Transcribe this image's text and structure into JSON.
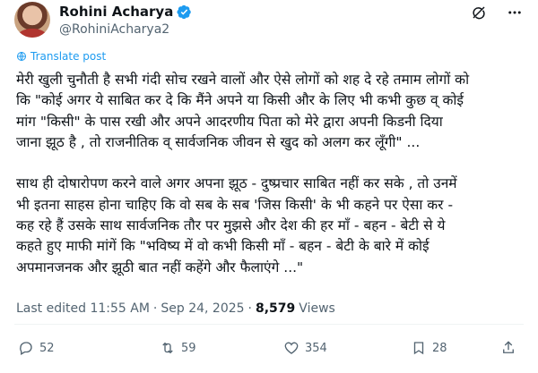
{
  "author": {
    "display_name": "Rohini Acharya",
    "handle": "@RohiniAcharya2"
  },
  "icons": {
    "verified": "verified-badge-icon",
    "grok": "grok-icon",
    "more": "more-icon"
  },
  "translate_label": "Translate post",
  "body": {
    "para1": [
      "मेरी खुली चुनौती है सभी गंदी सोच रखने वालों और ऐसे लोगों को शह दे रहे तमाम लोगों को",
      "कि \"कोई अगर ये साबित कर दे कि मैंने अपने या किसी और के लिए भी कभी कुछ व् कोई",
      "मांग \"किसी\" के पास रखी और अपने आदरणीय पिता को मेरे द्वारा अपनी किडनी दिया",
      "जाना झूठ है , तो राजनीतिक व् सार्वजनिक जीवन से खुद को अलग कर लूँगी\" ..."
    ],
    "para2": [
      "साथ ही दोषारोपण करने वाले अगर अपना झूठ - दुष्प्रचार साबित नहीं कर सके , तो उनमें",
      "भी इतना साहस होना चाहिए कि वो सब के सब 'जिस किसी' के भी कहने पर ऐसा कर -",
      "कह  रहे हैं उसके साथ सार्वजनिक तौर पर मुझसे और देश की हर माँ - बहन - बेटी से ये",
      "कहते हुए माफी मांगें कि \"भविष्य में वो कभी किसी माँ - बहन - बेटी के बारे में कोई",
      "अपमानजनक और झूठी बात नहीं कहेंगे और फैलाएंगे ...\""
    ]
  },
  "meta": {
    "edited": "Last edited 11:55 AM",
    "dot": "·",
    "date": "Sep 24, 2025",
    "views_count": "8,579",
    "views_label": "Views"
  },
  "actions": {
    "replies": "52",
    "reposts": "59",
    "likes": "354",
    "bookmarks": "28"
  },
  "colors": {
    "accent": "#1d9bf0",
    "secondary_text": "#536471"
  }
}
